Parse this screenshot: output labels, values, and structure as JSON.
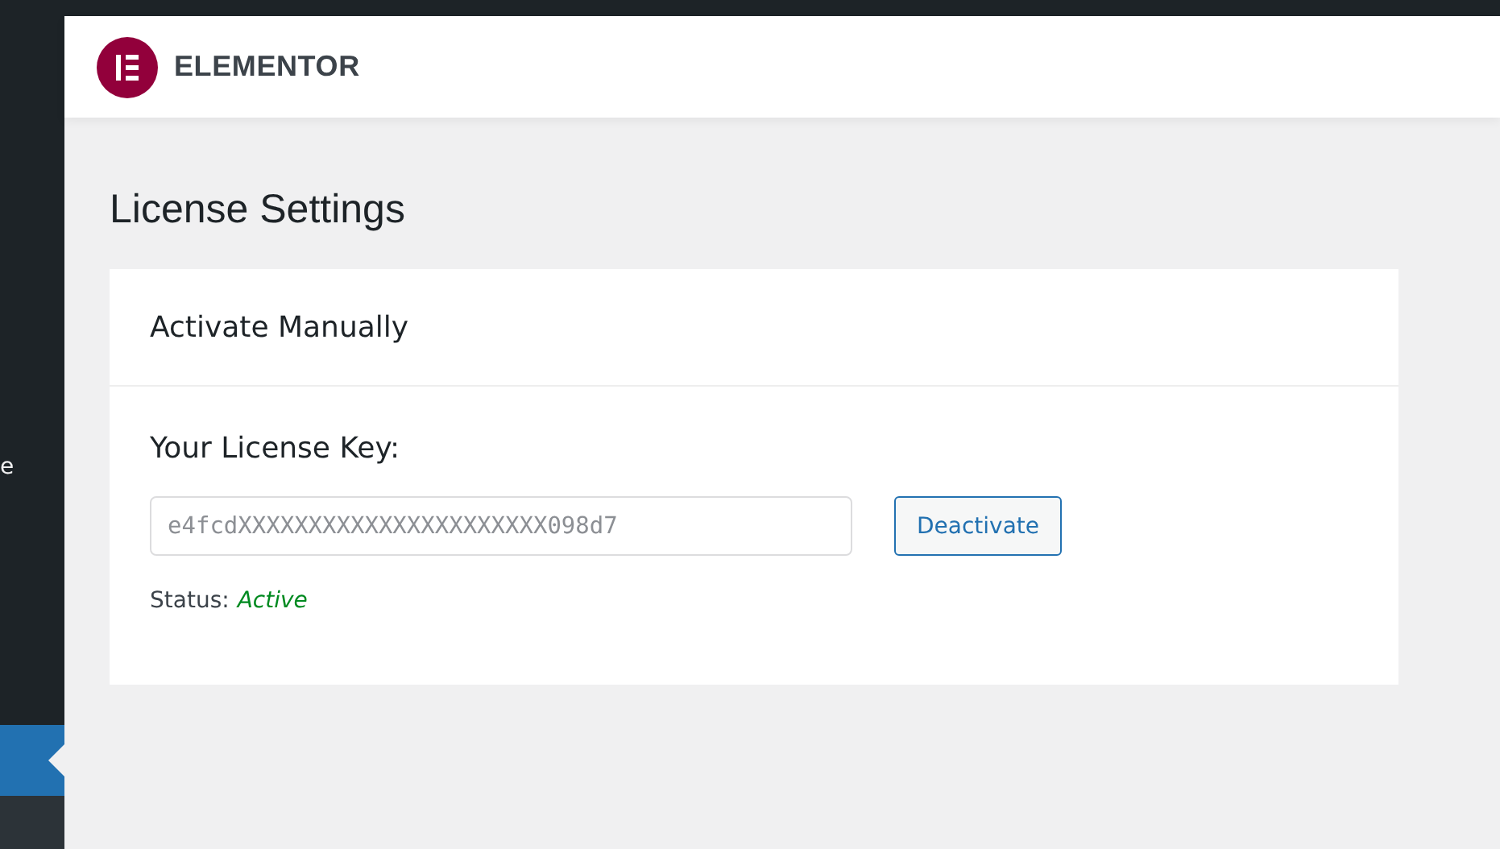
{
  "sidebar": {
    "items": [
      {
        "label": "e"
      }
    ]
  },
  "header": {
    "brand": "ELEMENTOR"
  },
  "page": {
    "title": "License Settings"
  },
  "card": {
    "title": "Activate Manually",
    "field_label": "Your License Key:",
    "license_key": "e4fcdXXXXXXXXXXXXXXXXXXXXXX098d7",
    "button": "Deactivate",
    "status_label": "Status:",
    "status_value": "Active"
  }
}
